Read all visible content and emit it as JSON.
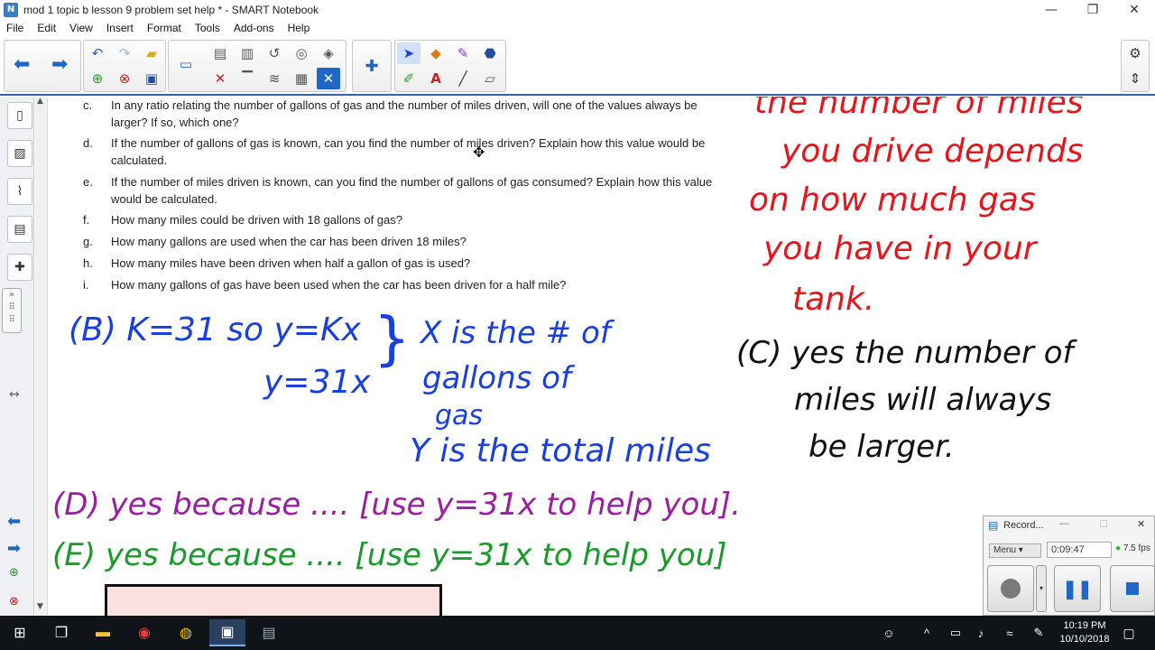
{
  "window": {
    "title": "mod 1 topic b lesson 9 problem set help * - SMART Notebook",
    "controls": [
      "—",
      "❐",
      "✕"
    ]
  },
  "menu": [
    "File",
    "Edit",
    "View",
    "Insert",
    "Format",
    "Tools",
    "Add-ons",
    "Help"
  ],
  "toolbar_icons": {
    "group1": [
      "undo-icon",
      "redo-icon",
      "open-folder-icon",
      "add-page-icon",
      "delete-page-icon",
      "save-icon"
    ],
    "group2": [
      "display-icon",
      "paste-icon",
      "screen-capture-icon",
      "clear-page-icon",
      "reset-page-icon",
      "full-screen-icon",
      "delete-icon",
      "screen-shade-icon",
      "dual-page-icon",
      "table-icon",
      "close-icon"
    ],
    "group3": [
      "select-icon",
      "shapes-icon",
      "magic-pen-icon",
      "fill-icon",
      "pens-icon",
      "text-icon",
      "lines-icon",
      "eraser-icon"
    ],
    "right": [
      "gear-icon",
      "move-toolbar-icon"
    ]
  },
  "questions": [
    {
      "letter": "c.",
      "text": "In any ratio relating the number of gallons of gas and the number of miles driven, will one of the values always be larger?  If so, which one?"
    },
    {
      "letter": "d.",
      "text": "If the number of gallons of gas is known, can you find the number of miles driven?  Explain how this value would be calculated."
    },
    {
      "letter": "e.",
      "text": "If the number of miles driven is known, can you find the number of gallons of gas consumed?  Explain how this value would be calculated."
    },
    {
      "letter": "f.",
      "text": "How many miles could be driven with 18 gallons of gas?"
    },
    {
      "letter": "g.",
      "text": "How many gallons are used when the car has been driven 18 miles?"
    },
    {
      "letter": "h.",
      "text": "How many miles have been driven when half a gallon of gas is used?"
    },
    {
      "letter": "i.",
      "text": "How many gallons of gas have been used when the car has been driven for a half mile?"
    }
  ],
  "handwriting": {
    "red": [
      "the number of miles",
      "you drive depends",
      "on how much gas",
      "you have in your",
      "tank."
    ],
    "blue_b": "(B) K=31  so  y=Kx",
    "blue_eq": "y=31x",
    "blue_notes": [
      "X is the # of",
      "gallons of",
      "gas",
      "Y is the total miles"
    ],
    "black_c": [
      "(C) yes the number of",
      "miles will always",
      "be larger."
    ],
    "purple_d": "(D) yes because .... [use y=31x to help you].",
    "green_e": "(E) yes because .... [use y=31x to help you]"
  },
  "recorder": {
    "title": "Record...",
    "menu_label": "Menu",
    "time": "0:09:47",
    "fps": "7.5 fps"
  },
  "clock": {
    "time": "10:19 PM",
    "date": "10/10/2018"
  }
}
